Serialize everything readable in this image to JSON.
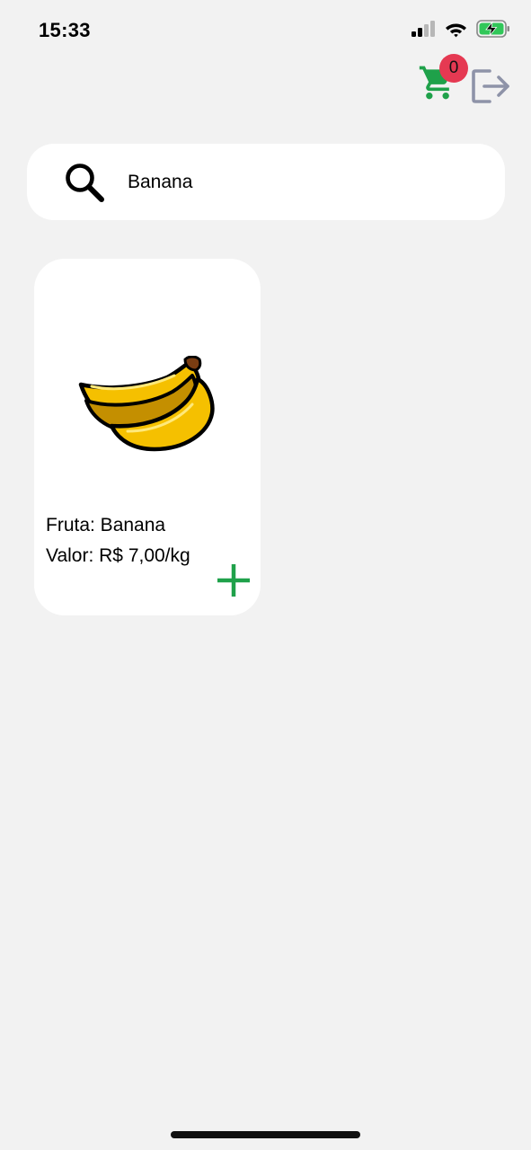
{
  "status_bar": {
    "time": "15:33",
    "icons": [
      "signal-icon",
      "wifi-icon",
      "battery-charging-icon"
    ]
  },
  "header": {
    "cart_count": "0",
    "cart_icon": "shopping-cart-icon",
    "logout_icon": "logout-icon"
  },
  "search": {
    "value": "Banana",
    "icon": "search-icon"
  },
  "products": [
    {
      "name": "Fruta: Banana",
      "price": "Valor: R$ 7,00/kg",
      "image": "banana-image",
      "add_icon": "plus-icon"
    }
  ],
  "colors": {
    "background": "#f2f2f2",
    "card": "#ffffff",
    "accent_green": "#1fa14a",
    "badge_red": "#e53952",
    "logout_gray": "#8e93a8",
    "banana_yellow": "#f5c000"
  }
}
